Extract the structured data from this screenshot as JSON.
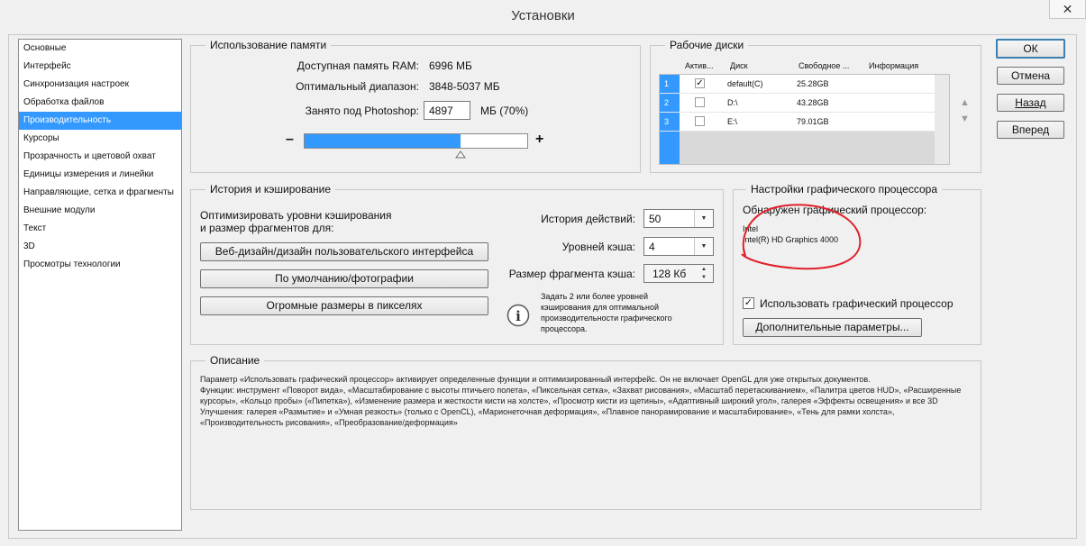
{
  "window": {
    "title": "Установки",
    "close_glyph": "✕"
  },
  "sidebar": {
    "items": [
      {
        "label": "Основные"
      },
      {
        "label": "Интерфейс"
      },
      {
        "label": "Синхронизация настроек"
      },
      {
        "label": "Обработка файлов"
      },
      {
        "label": "Производительность",
        "selected": true
      },
      {
        "label": "Курсоры"
      },
      {
        "label": "Прозрачность и цветовой охват"
      },
      {
        "label": "Единицы измерения и линейки"
      },
      {
        "label": "Направляющие, сетка и фрагменты"
      },
      {
        "label": "Внешние модули"
      },
      {
        "label": "Текст"
      },
      {
        "label": "3D"
      },
      {
        "label": "Просмотры технологии"
      }
    ]
  },
  "memory": {
    "legend": "Использование памяти",
    "available_label": "Доступная память RAM:",
    "available_value": "6996 МБ",
    "range_label": "Оптимальный диапазон:",
    "range_value": "3848-5037 МБ",
    "used_label": "Занято под Photoshop:",
    "used_value": "4897",
    "used_unit": "МБ (70%)",
    "slider_fraction": 0.7,
    "minus": "–",
    "plus": "+"
  },
  "disks": {
    "legend": "Рабочие диски",
    "columns": [
      "Актив...",
      "Диск",
      "Свободное ...",
      "Информация"
    ],
    "rows": [
      {
        "num": "1",
        "active": true,
        "disk": "default(C)",
        "free": "25.28GB"
      },
      {
        "num": "2",
        "active": false,
        "disk": "D:\\",
        "free": "43.28GB"
      },
      {
        "num": "3",
        "active": false,
        "disk": "E:\\",
        "free": "79.01GB"
      }
    ],
    "up_glyph": "▲",
    "down_glyph": "▼"
  },
  "history": {
    "legend": "История и кэширование",
    "optimize_line1": "Оптимизировать уровни кэширования",
    "optimize_line2": "и размер фрагментов для:",
    "btn_web": "Веб-дизайн/дизайн пользовательского интерфейса",
    "btn_default": "По умолчанию/фотографии",
    "btn_huge": "Огромные размеры в пикселях",
    "history_label": "История действий:",
    "history_value": "50",
    "cache_levels_label": "Уровней кэша:",
    "cache_levels_value": "4",
    "tile_label": "Размер фрагмента кэша:",
    "tile_value": "128 Кб",
    "info_icon_glyph": "i",
    "hint_lines": [
      "Задать 2 или более уровней",
      "кэширования для оптимальной",
      "производительности графического",
      "процессора."
    ]
  },
  "gpu": {
    "legend": "Настройки графического процессора",
    "detected_label": "Обнаружен графический процессор:",
    "vendor": "Intel",
    "model": "Intel(R) HD Graphics 4000",
    "use_gpu_label": "Использовать графический процессор",
    "use_gpu_checked": true,
    "advanced_button": "Дополнительные параметры...",
    "annotation_color": "#e0202a"
  },
  "description": {
    "legend": "Описание",
    "paragraphs": [
      "Параметр «Использовать графический процессор» активирует определенные функции и оптимизированный интерфейс. Он не включает OpenGL для уже открытых документов.",
      "Функции: инструмент «Поворот вида», «Масштабирование с высоты птичьего полета», «Пиксельная сетка», «Захват рисования», «Масштаб перетаскиванием», «Палитра цветов HUD», «Расширенные курсоры», «Кольцо пробы» («Пипетка»), «Изменение размера и жесткости кисти на холсте», «Просмотр кисти из щетины», «Адаптивный широкий угол», галерея «Эффекты освещения» и все 3D",
      "Улучшения: галерея «Размытие» и «Умная резкость» (только с OpenCL), «Марионеточная деформация», «Плавное панорамирование и масштабирование», «Тень для рамки холста», «Производительность рисования», «Преобразование/деформация»"
    ]
  },
  "buttons": {
    "ok": "ОК",
    "cancel": "Отмена",
    "back": "Назад",
    "forward": "Вперед"
  },
  "colors": {
    "selection": "#3399ff",
    "slider_fill": "#3399ff"
  }
}
